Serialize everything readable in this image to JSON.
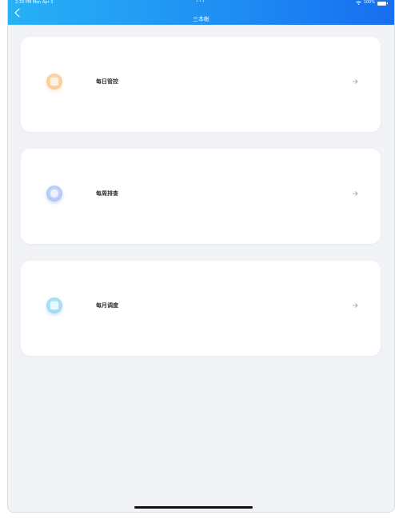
{
  "status_bar": {
    "time": "2:33 PM  Mon Apr 3",
    "dots": "•••",
    "battery_text": "100%"
  },
  "nav": {
    "title": "三本帐"
  },
  "cards": [
    {
      "label": "每日管控",
      "icon": "document-icon",
      "color": "#f7bf88"
    },
    {
      "label": "每周排查",
      "icon": "search-icon",
      "color": "#9fb8f1"
    },
    {
      "label": "每月调度",
      "icon": "schedule-icon",
      "color": "#86cdf2"
    }
  ],
  "colors": {
    "header_start": "#27b1f6",
    "header_end": "#176ef0",
    "background": "#f1f3f7",
    "card": "#ffffff"
  }
}
